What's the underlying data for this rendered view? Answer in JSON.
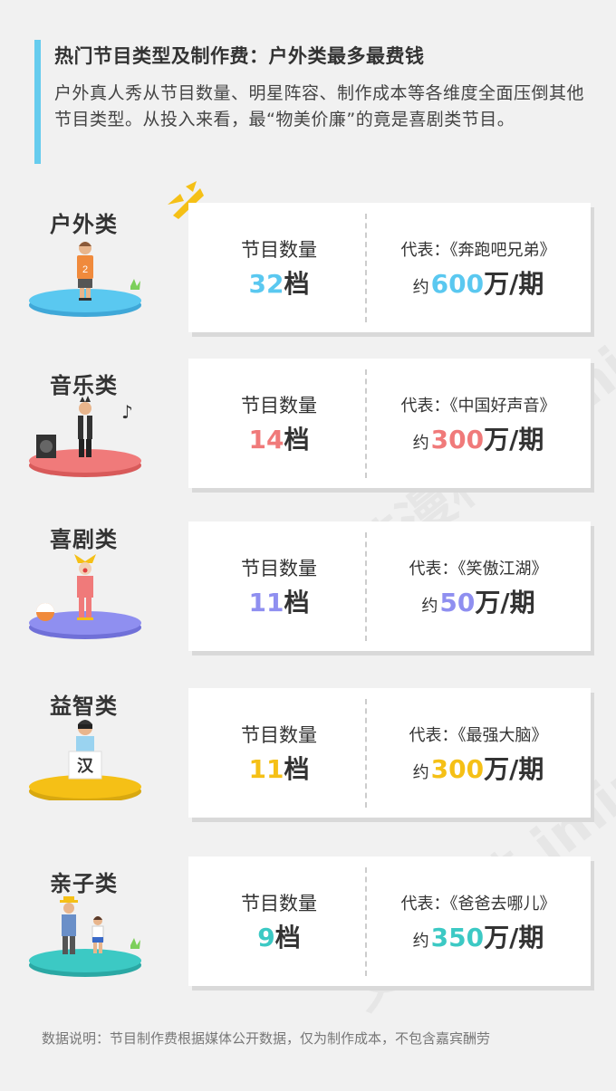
{
  "title": "热门节目类型及制作费：户外类最多最费钱",
  "intro": "户外真人秀从节目数量、明星阵容、制作成本等各维度全面压倒其他节目类型。从投入来看，最“物美价廉”的竟是喜剧类节目。",
  "footnote": "数据说明：节目制作费根据媒体公开数据，仅为制作成本，不包含嘉宾酬劳",
  "count_label": "节目数量",
  "count_unit": "档",
  "rep_prefix": "代表：",
  "cost_prefix": "约",
  "cost_suffix": "万/期",
  "watermark": "艾漫科技 iminer.com",
  "colors": {
    "accent": "#66ccee",
    "outdoor": "#5ac8f0",
    "music": "#f07a7a",
    "comedy": "#8f8ff0",
    "puzzle": "#f5c016",
    "family": "#3cc9c4"
  },
  "chart_data": {
    "type": "table",
    "categories": [
      "户外类",
      "音乐类",
      "喜剧类",
      "益智类",
      "亲子类"
    ],
    "series": [
      {
        "name": "节目数量",
        "unit": "档",
        "values": [
          32,
          14,
          11,
          11,
          9
        ]
      },
      {
        "name": "制作费",
        "unit": "万/期",
        "values": [
          600,
          300,
          50,
          300,
          350
        ]
      }
    ],
    "representatives": [
      "《奔跑吧兄弟》",
      "《中国好声音》",
      "《笑傲江湖》",
      "《最强大脑》",
      "《爸爸去哪儿》"
    ],
    "rows": [
      {
        "category": "户外类",
        "count": "32",
        "rep": "《奔跑吧兄弟》",
        "cost": "600",
        "color": "#5ac8f0"
      },
      {
        "category": "音乐类",
        "count": "14",
        "rep": "《中国好声音》",
        "cost": "300",
        "color": "#f07a7a"
      },
      {
        "category": "喜剧类",
        "count": "11",
        "rep": "《笑傲江湖》",
        "cost": "50",
        "color": "#8f8ff0"
      },
      {
        "category": "益智类",
        "count": "11",
        "rep": "《最强大脑》",
        "cost": "300",
        "color": "#f5c016"
      },
      {
        "category": "亲子类",
        "count": "9",
        "rep": "《爸爸去哪儿》",
        "cost": "350",
        "color": "#3cc9c4"
      }
    ],
    "figure_texts": {
      "jersey_number": "2",
      "box_char": "汉"
    }
  }
}
